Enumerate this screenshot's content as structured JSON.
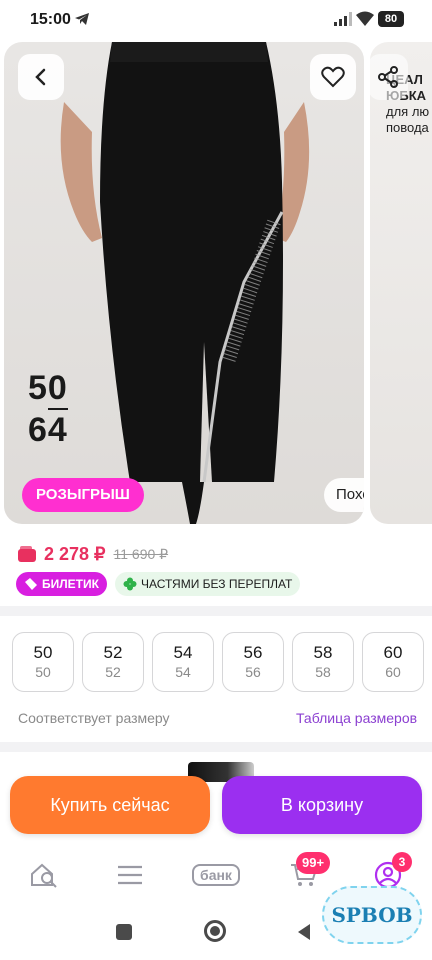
{
  "status_bar": {
    "time": "15:00",
    "battery": "80"
  },
  "gallery": {
    "size_badge_top": "50",
    "size_badge_bottom": "64",
    "raffle_label": "РОЗЫГРЫШ",
    "similar_label": "Похожие",
    "next_photo_title": "ЦЕАЛ\nЮБКА",
    "next_photo_sub": "для лю\nповода"
  },
  "price": {
    "current": "2 278 ₽",
    "old": "11 690 ₽"
  },
  "tags": {
    "ticket": "БИЛЕТИК",
    "installments": "ЧАСТЯМИ БЕЗ ПЕРЕПЛАТ"
  },
  "sizes": {
    "items": [
      {
        "main": "50",
        "sub": "50"
      },
      {
        "main": "52",
        "sub": "52"
      },
      {
        "main": "54",
        "sub": "54"
      },
      {
        "main": "56",
        "sub": "56"
      },
      {
        "main": "58",
        "sub": "58"
      },
      {
        "main": "60",
        "sub": "60"
      }
    ],
    "fit_text": "Соответствует размеру",
    "table_link": "Таблица размеров"
  },
  "actions": {
    "buy_now": "Купить сейчас",
    "to_cart": "В корзину"
  },
  "bottom_nav": {
    "bank_label": "банк",
    "cart_badge": "99+",
    "profile_badge": "3"
  },
  "watermark": "SPBOB",
  "colors": {
    "accent_pink": "#ff2fd0",
    "price_red": "#e8305f",
    "buy_orange": "#ff7a2f",
    "cart_purple": "#9b2ff0",
    "link_purple": "#8b3fd1"
  }
}
